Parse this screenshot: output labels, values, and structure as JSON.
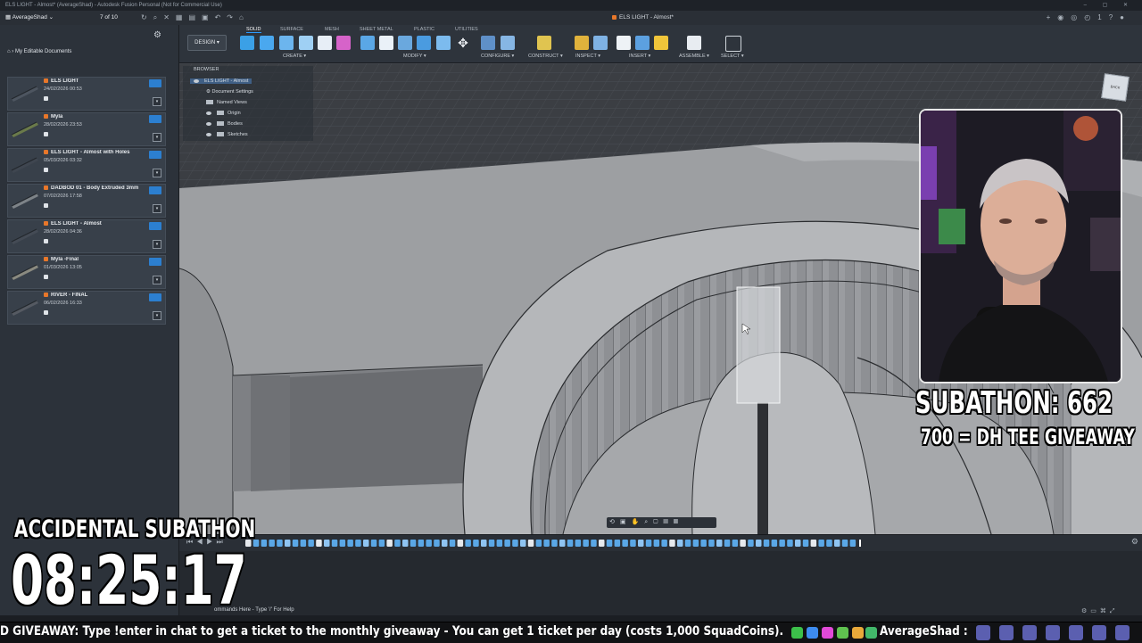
{
  "window": {
    "title": "ELS LIGHT - Almost* (AverageShad) - Autodesk Fusion Personal (Not for Commercial Use)",
    "controls": [
      "–",
      "▢",
      "✕"
    ]
  },
  "appbar": {
    "account": "AverageShad ⌄",
    "pages": "7 of 10",
    "doc_tab": "ELS LIGHT - Almost*",
    "right_badge": "1"
  },
  "data_panel": {
    "breadcrumb": "My Editable Documents",
    "documents": [
      {
        "name": "ELS LIGHT",
        "date": "24/02/2026 00:53"
      },
      {
        "name": "Myla",
        "date": "28/02/2026 23:53"
      },
      {
        "name": "ELS LIGHT - Almost with Holes",
        "date": "05/03/2026 03:32"
      },
      {
        "name": "DADBOD 01 - Body Extruded 3mm",
        "date": "07/02/2026 17:58"
      },
      {
        "name": "ELS LIGHT - Almost",
        "date": "28/02/2026 04:36"
      },
      {
        "name": "Myla -Final",
        "date": "01/03/2026 13:05"
      },
      {
        "name": "RIVER - FINAL",
        "date": "06/02/2026 16:33"
      }
    ]
  },
  "toolbar": {
    "workspace": "DESIGN ▾",
    "tabs": [
      "SOLID",
      "SURFACE",
      "MESH",
      "SHEET METAL",
      "PLASTIC",
      "UTILITIES"
    ],
    "active_tab": "SOLID",
    "groups": [
      "CREATE ▾",
      "MODIFY ▾",
      "CONFIGURE ▾",
      "CONSTRUCT ▾",
      "INSPECT ▾",
      "INSERT ▾",
      "ASSEMBLE ▾",
      "SELECT ▾"
    ]
  },
  "browser": {
    "header": "BROWSER",
    "root": "ELS LIGHT - Almost",
    "nodes": [
      "Document Settings",
      "Named Views",
      "Origin",
      "Bodies",
      "Sketches"
    ]
  },
  "viewcube": {
    "label": "BACK"
  },
  "overlay": {
    "subathon_count": "SUBATHON: 662",
    "giveaway_line": "700 = DH TEE GIVEAWAY",
    "accidental": "ACCIDENTAL SUBATHON",
    "timer": "08:25:17"
  },
  "command_line": {
    "hint": "ommands Here - Type '/' For Help"
  },
  "ticker": {
    "message": "D GIVEAWAY: Type !enter in chat to get a ticket to the monthly giveaway - You can get 1 ticket per day (costs 1,000 SquadCoins).",
    "user": "AverageShad :"
  },
  "colors": {
    "accent": "#2c9bff",
    "doc_icon": "#e8772a",
    "viewport_dark": "#3a3d42",
    "model_light": "#a9abae"
  }
}
